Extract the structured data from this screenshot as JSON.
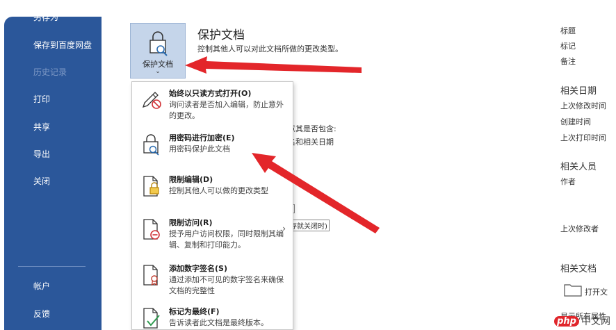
{
  "sidebar": {
    "items": [
      {
        "label": "另存为"
      },
      {
        "label": "保存到百度网盘"
      },
      {
        "label": "历史记录"
      },
      {
        "label": "打印"
      },
      {
        "label": "共享"
      },
      {
        "label": "导出"
      },
      {
        "label": "关闭"
      },
      {
        "label": "帐户"
      },
      {
        "label": "反馈"
      }
    ]
  },
  "protect": {
    "button_label": "保护文档",
    "chevron": "⌄",
    "title": "保护文档",
    "description": "控制其他人可以对此文档所做的更改类型。"
  },
  "background": {
    "inspect_text_1": "意其是否包含:",
    "inspect_text_2": "名和相关日期",
    "box_1": ")",
    "box_2": "存就关闭时)"
  },
  "menu": {
    "items": [
      {
        "icon": "pencil-no-icon",
        "title": "始终以只读方式打开(O)",
        "desc": "询问读者是否加入编辑，防止意外的更改。"
      },
      {
        "icon": "lock-search-icon",
        "title": "用密码进行加密(E)",
        "desc": "用密码保护此文档"
      },
      {
        "icon": "doc-lock-icon",
        "title": "限制编辑(D)",
        "desc": "控制其他人可以做的更改类型"
      },
      {
        "icon": "doc-restrict-icon",
        "title": "限制访问(R)",
        "desc": "授予用户访问权限，同时限制其编辑、复制和打印能力。",
        "arrow": "›"
      },
      {
        "icon": "doc-signature-icon",
        "title": "添加数字签名(S)",
        "desc": "通过添加不可见的数字签名来确保文档的完整性"
      },
      {
        "icon": "doc-final-icon",
        "title": "标记为最终(F)",
        "desc": "告诉读者此文档是最终版本。"
      }
    ]
  },
  "properties": {
    "fields": [
      "标题",
      "标记",
      "备注"
    ],
    "dates_heading": "相关日期",
    "dates": [
      "上次修改时间",
      "创建时间",
      "上次打印时间"
    ],
    "people_heading": "相关人员",
    "author": "作者",
    "last_modified_by": "上次修改者",
    "docs_heading": "相关文档",
    "open_location": "打开文",
    "show_all": "显示所有属性"
  },
  "watermark": {
    "badge": "php",
    "text": "中文网"
  },
  "colors": {
    "sidebar": "#2b579a",
    "arrow": "#e3262a",
    "button": "#c5d5ea"
  }
}
